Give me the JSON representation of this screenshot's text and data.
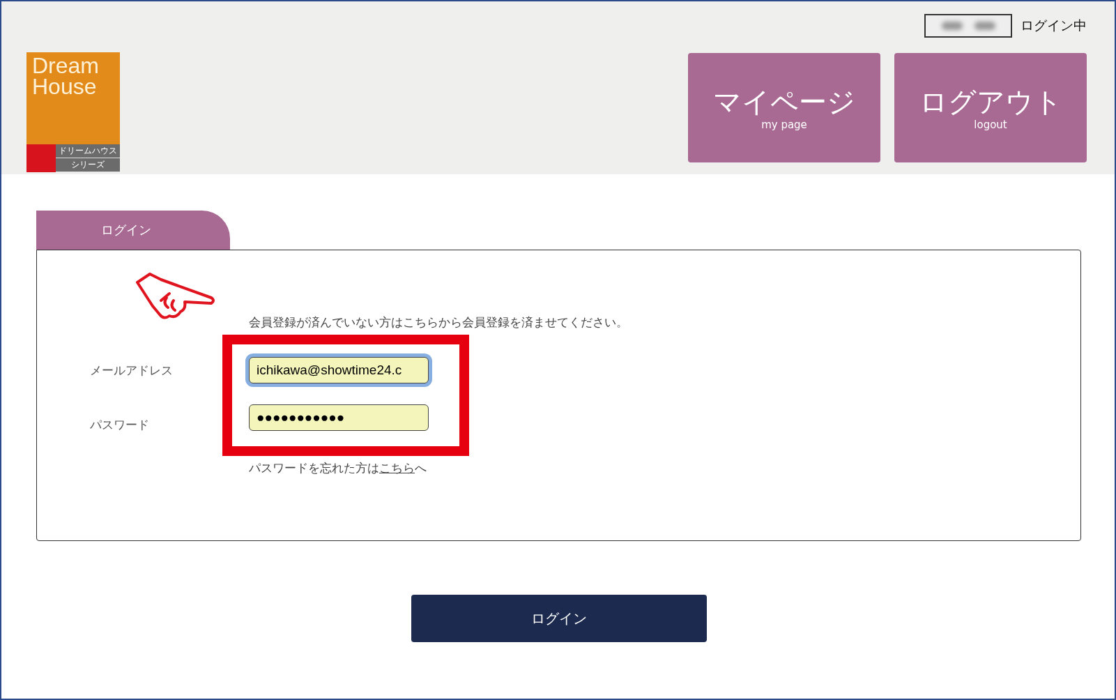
{
  "header": {
    "logo": {
      "title_lines": [
        "Dream",
        "House"
      ],
      "sub_lines": [
        "ドリームハウス",
        "シリーズ"
      ]
    },
    "user_status": "ログイン中",
    "nav_buttons": [
      {
        "label": "マイページ",
        "sublabel": "my page"
      },
      {
        "label": "ログアウト",
        "sublabel": "logout"
      }
    ]
  },
  "tab": {
    "label": "ログイン",
    "selected": true
  },
  "form": {
    "notice": "会員登録が済んでいない方はこちらから会員登録を済ませてください。",
    "fields": [
      {
        "label": "メールアドレス",
        "value": "ichikawa@showtime24.c",
        "focused": true
      },
      {
        "label": "パスワード",
        "value": "●●●●●●●●●●●",
        "focused": false
      }
    ],
    "forgot": {
      "before": "パスワードを忘れた方は",
      "link": "こちら",
      "after": "へ"
    }
  },
  "submit": "ログイン"
}
